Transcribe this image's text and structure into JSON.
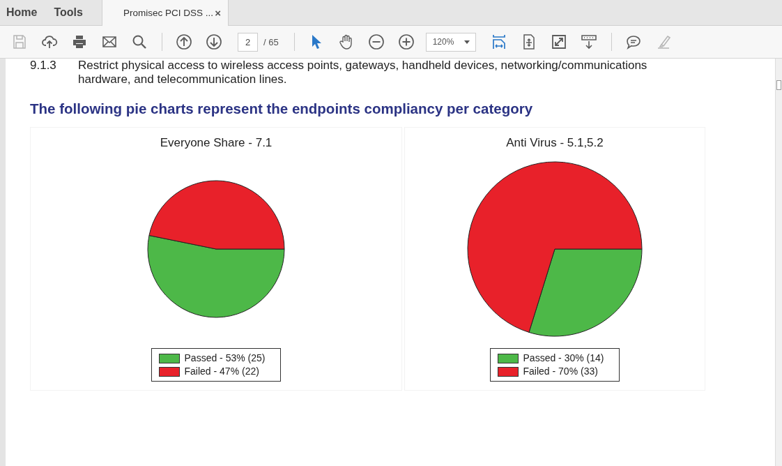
{
  "tabs": [
    {
      "label": "Home",
      "kind": "nav",
      "selected": false
    },
    {
      "label": "Tools",
      "kind": "nav",
      "selected": false
    },
    {
      "label": "Promisec PCI DSS ...",
      "kind": "doc",
      "selected": true,
      "close": "×"
    }
  ],
  "toolbar": {
    "page": "2",
    "page_total": "/ 65",
    "zoom": "120%"
  },
  "document": {
    "item_number": "9.1.3",
    "item_lines": [
      "Restrict physical access to wireless access points, gateways, handheld devices, networking/communications",
      "hardware, and telecommunication lines."
    ],
    "heading": "The following pie charts represent the endpoints compliancy per category",
    "charts": [
      {
        "chart_data": {
          "type": "pie",
          "title": "Everyone Share - 7.1",
          "categories": [
            "Passed - 53% (25)",
            "Failed - 47% (22)"
          ],
          "values": [
            25,
            22
          ],
          "legend": "bottom",
          "colors": [
            "#4db848",
            "#e8212a"
          ]
        }
      },
      {
        "chart_data": {
          "type": "pie",
          "title": "Anti Virus - 5.1,5.2",
          "categories": [
            "Passed - 30% (14)",
            "Failed - 70% (33)"
          ],
          "values": [
            14,
            33
          ],
          "legend": "bottom",
          "colors": [
            "#4db848",
            "#e8212a"
          ]
        }
      }
    ]
  }
}
